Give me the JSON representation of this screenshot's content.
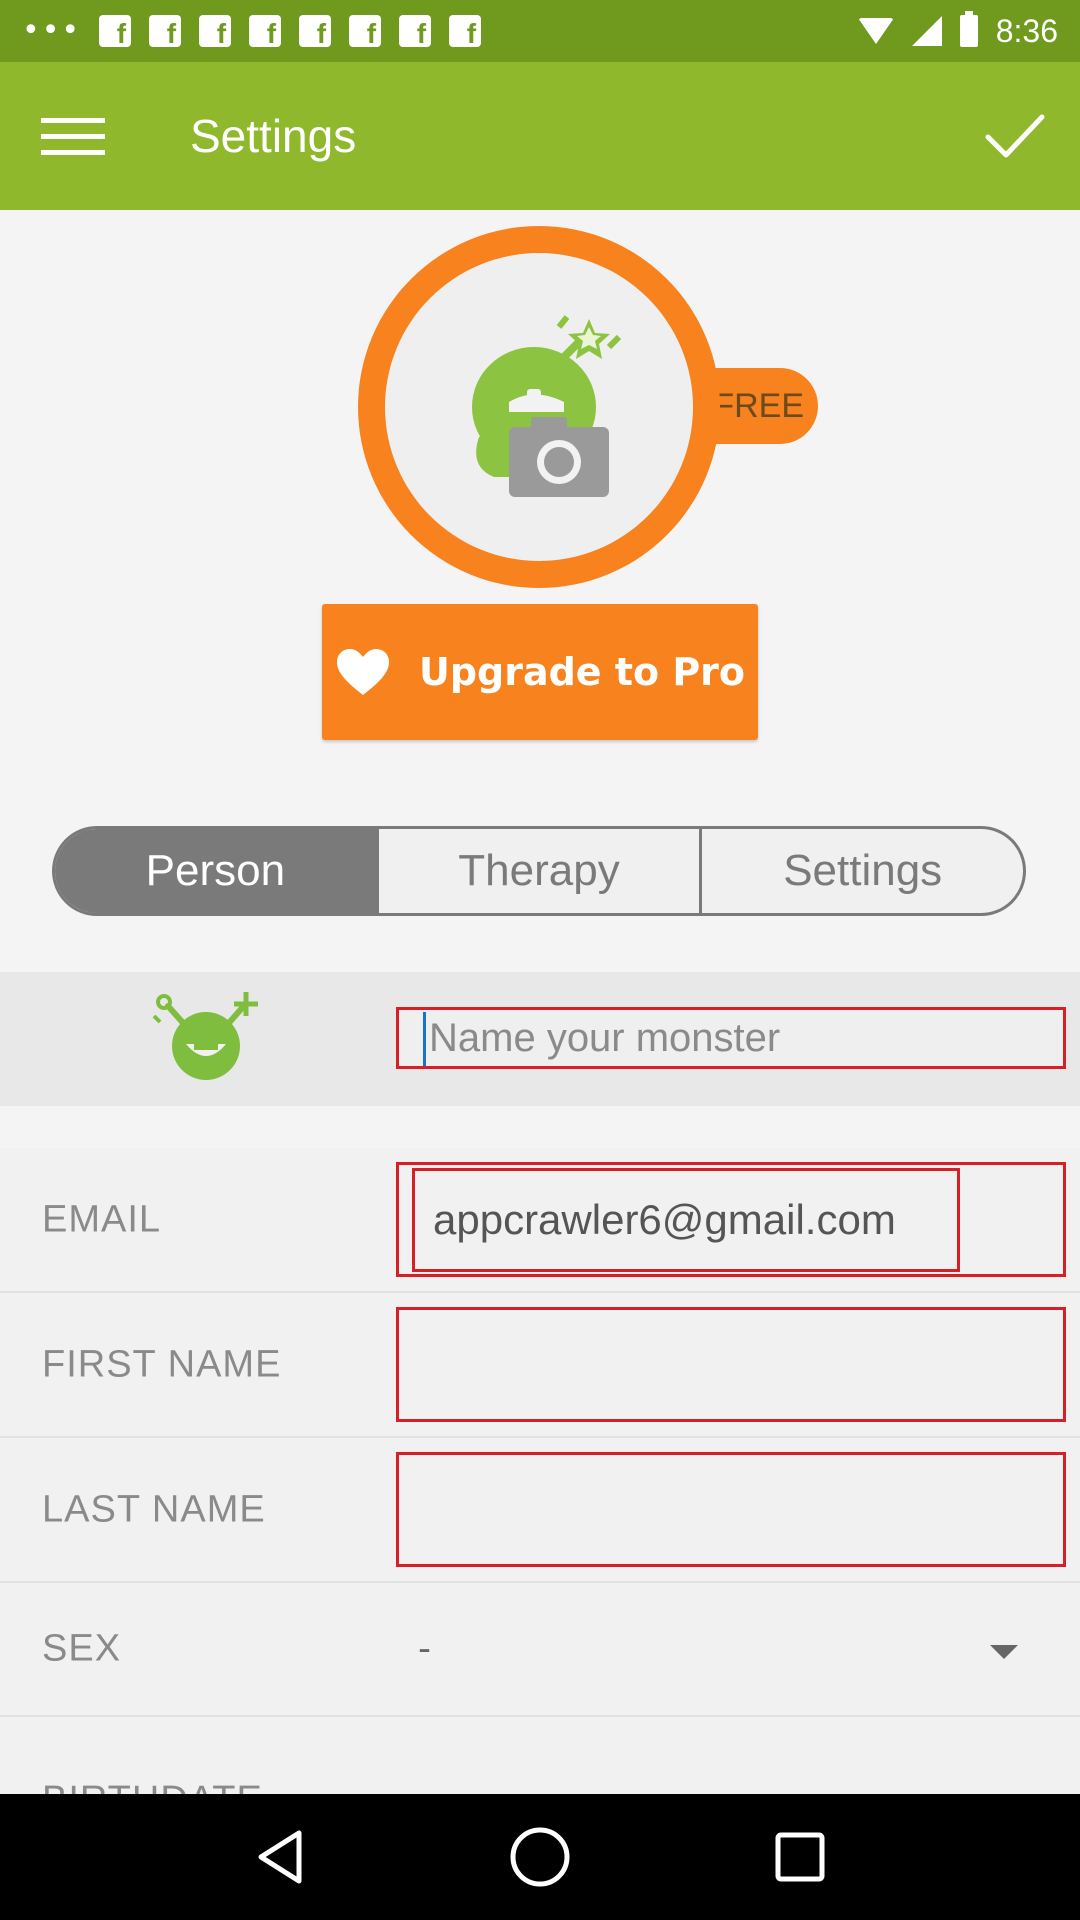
{
  "status_bar": {
    "time": "8:36",
    "notification_icons": [
      "more-dots-icon",
      "facebook-icon",
      "facebook-icon",
      "facebook-icon",
      "facebook-icon",
      "facebook-icon",
      "facebook-icon",
      "facebook-icon",
      "facebook-icon"
    ],
    "right_icons": [
      "wifi-icon",
      "signal-icon",
      "battery-icon"
    ]
  },
  "app_bar": {
    "title": "Settings",
    "menu_icon": "hamburger-menu-icon",
    "confirm_icon": "check-icon"
  },
  "avatar": {
    "badge": "FREE",
    "icon": "monster-camera-icon"
  },
  "upgrade": {
    "label": "Upgrade to Pro",
    "icon": "heart-icon"
  },
  "tabs": [
    {
      "label": "Person",
      "active": true
    },
    {
      "label": "Therapy",
      "active": false
    },
    {
      "label": "Settings",
      "active": false
    }
  ],
  "monster_name": {
    "placeholder": "Name your monster",
    "value": ""
  },
  "form": {
    "email": {
      "label": "EMAIL",
      "value": "appcrawler6@gmail.com"
    },
    "first_name": {
      "label": "FIRST NAME",
      "value": ""
    },
    "last_name": {
      "label": "LAST NAME",
      "value": ""
    },
    "sex": {
      "label": "SEX",
      "value": "-"
    },
    "birthdate": {
      "label": "BIRTHDATE"
    }
  },
  "colors": {
    "app_bar": "#8fb82d",
    "status_bar": "#6f9a1d",
    "accent_orange": "#f7821e",
    "highlight_red": "#d81f26",
    "monster_green": "#7fbd3f"
  }
}
